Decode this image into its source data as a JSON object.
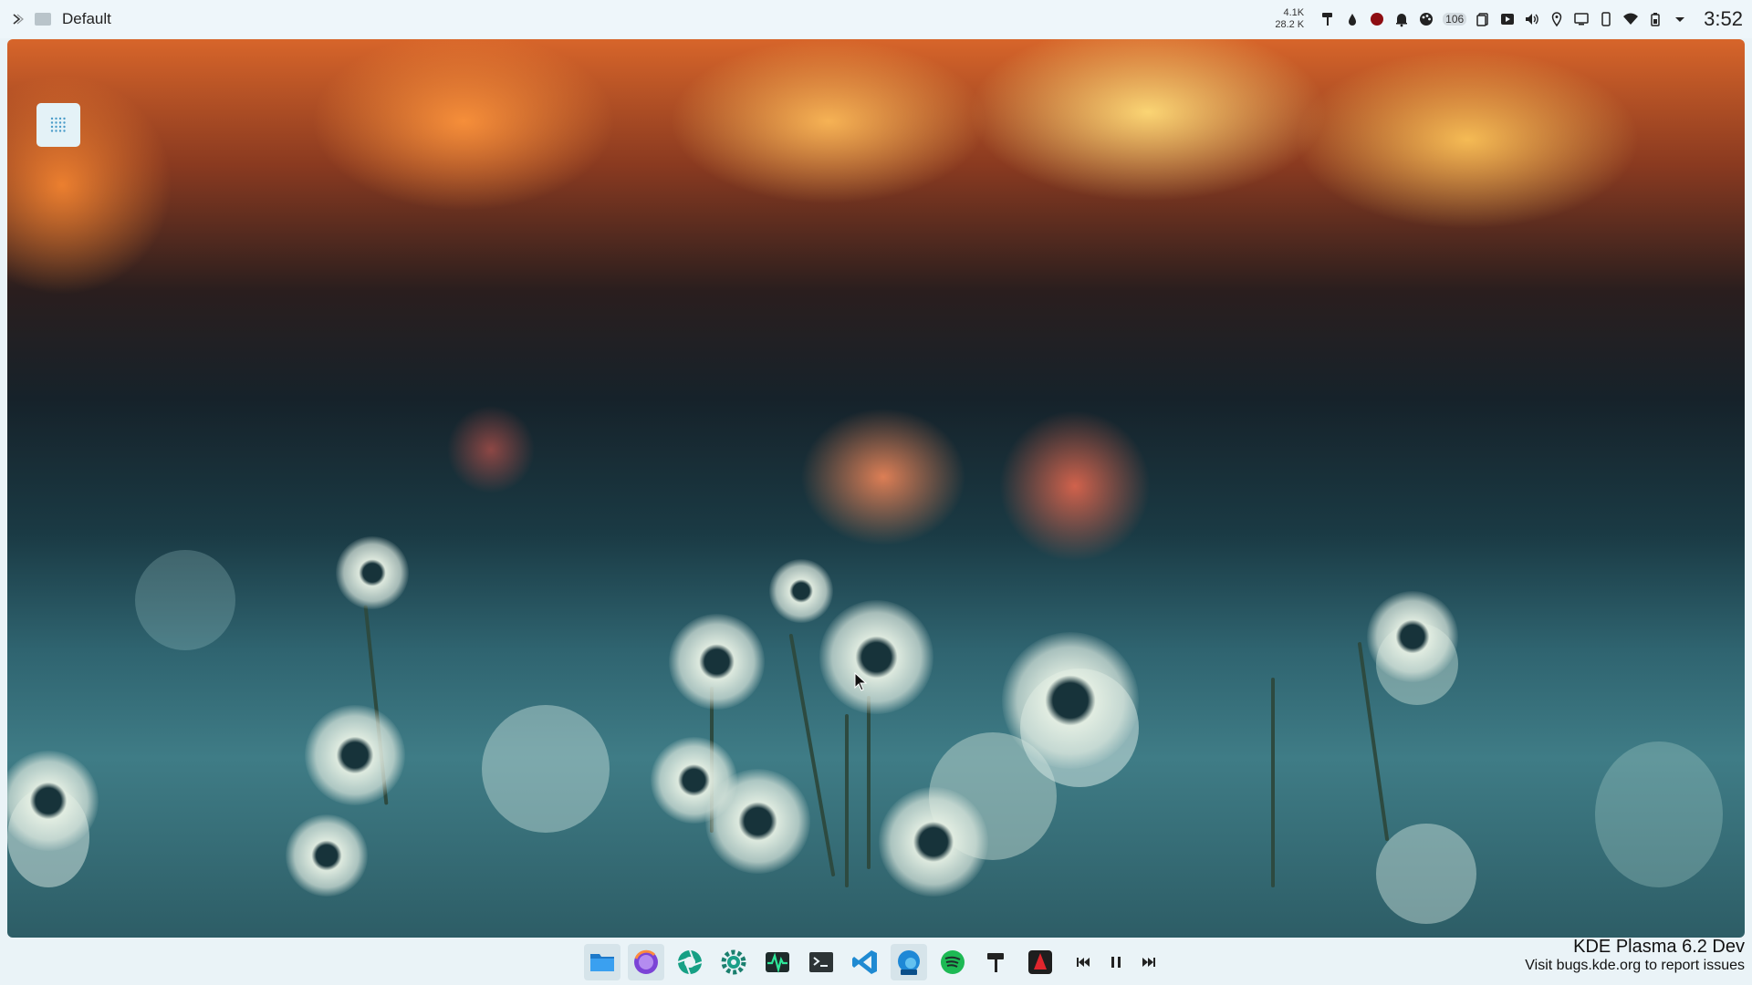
{
  "top_panel": {
    "window_title": "Default",
    "net_up": "4.1K",
    "net_down": "28.2 K",
    "notification_count": "106",
    "clock": "3:52"
  },
  "desktop": {
    "wallpaper": "dandelions-at-sunset"
  },
  "taskbar": {
    "apps": [
      {
        "name": "files-icon"
      },
      {
        "name": "firefox-icon"
      },
      {
        "name": "aperture-icon"
      },
      {
        "name": "settings-gear-icon"
      },
      {
        "name": "system-monitor-icon"
      },
      {
        "name": "terminal-icon"
      },
      {
        "name": "vscode-icon"
      },
      {
        "name": "edge-beta-icon"
      },
      {
        "name": "spotify-icon"
      },
      {
        "name": "paint-roller-icon"
      },
      {
        "name": "red-app-icon"
      }
    ]
  },
  "watermark": {
    "title": "KDE Plasma 6.2 Dev",
    "subtitle": "Visit bugs.kde.org to report issues"
  },
  "colors": {
    "panel_bg": "#eef6fa",
    "accent": "#1d99f3"
  }
}
